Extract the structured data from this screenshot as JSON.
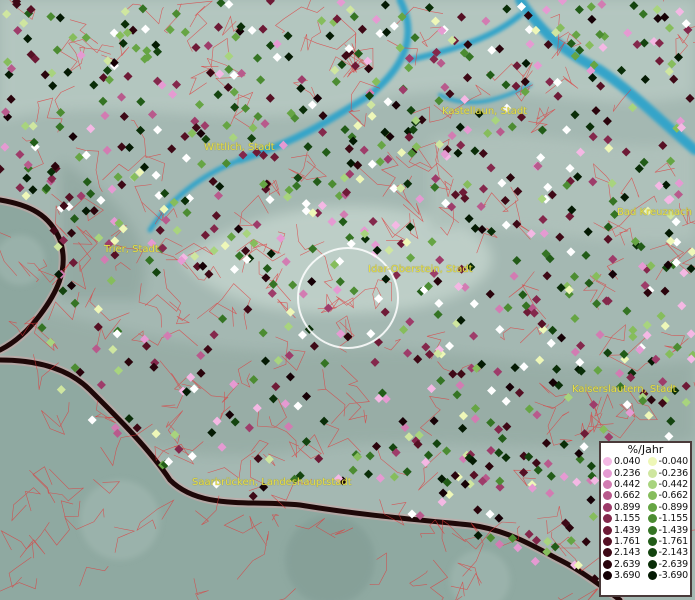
{
  "map": {
    "labels": [
      {
        "name": "Kastellaun, Stadt",
        "key": "kastellaun"
      },
      {
        "name": "Wittlich, Stadt",
        "key": "wittlich"
      },
      {
        "name": "Bad Kreuznach",
        "key": "bad-kreuznach"
      },
      {
        "name": "Trier, Stadt",
        "key": "trier"
      },
      {
        "name": "Idar-Oberstein, Stadt",
        "key": "idar-oberstein"
      },
      {
        "name": "Kaiserslautern, Stadt",
        "key": "kaiserslautern"
      },
      {
        "name": "Saarbrücken, Landeshauptstadt",
        "key": "saarbruecken"
      }
    ],
    "colors": {
      "terrain": "#9fb3ad",
      "water": "#3aa6c8",
      "boundary": "#e0393a",
      "label": "#e8e04a",
      "border": "#2a0f0f",
      "highlight_circle": "#ffffff"
    }
  },
  "legend": {
    "title": "%/Jahr",
    "positive": [
      {
        "value": "0.040",
        "color": "#f4b8e4"
      },
      {
        "value": "0.236",
        "color": "#e59ad2"
      },
      {
        "value": "0.442",
        "color": "#d27cb2"
      },
      {
        "value": "0.662",
        "color": "#b85a8c"
      },
      {
        "value": "0.899",
        "color": "#9e3c6a"
      },
      {
        "value": "1.155",
        "color": "#84284c"
      },
      {
        "value": "1.439",
        "color": "#6e1a36"
      },
      {
        "value": "1.761",
        "color": "#561024"
      },
      {
        "value": "2.143",
        "color": "#3e0916"
      },
      {
        "value": "2.639",
        "color": "#2a040c"
      },
      {
        "value": "3.690",
        "color": "#160106"
      }
    ],
    "negative": [
      {
        "value": "-0.040",
        "color": "#eef7b8"
      },
      {
        "value": "-0.236",
        "color": "#cfe6a0"
      },
      {
        "value": "-0.442",
        "color": "#a8d47e"
      },
      {
        "value": "-0.662",
        "color": "#86bd5c"
      },
      {
        "value": "-0.899",
        "color": "#66a544"
      },
      {
        "value": "-1.155",
        "color": "#4c8c32"
      },
      {
        "value": "-1.439",
        "color": "#357424"
      },
      {
        "value": "-1.761",
        "color": "#225c18"
      },
      {
        "value": "-2.143",
        "color": "#14440f"
      },
      {
        "value": "-2.639",
        "color": "#0a2e08"
      },
      {
        "value": "-3.690",
        "color": "#041a03"
      }
    ]
  }
}
